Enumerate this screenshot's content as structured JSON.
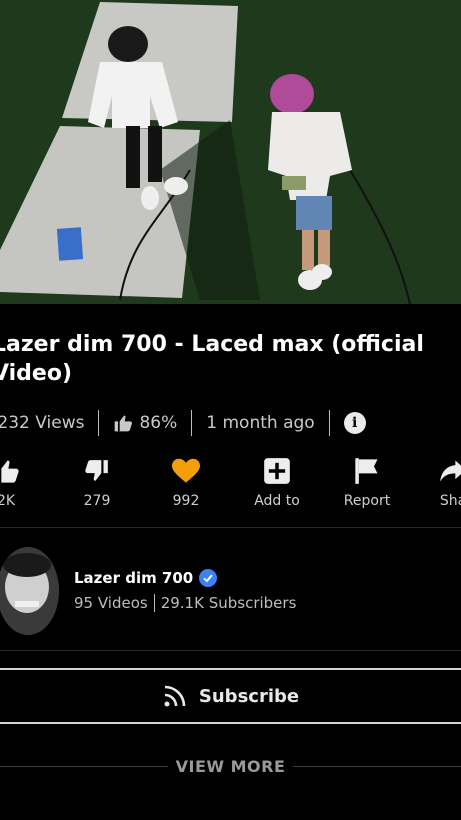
{
  "video": {
    "title": "Lazer dim 700 - Laced max (official Video)"
  },
  "stats": {
    "views": ",232 Views",
    "like_percent": "86%",
    "age": "1 month ago"
  },
  "actions": [
    {
      "icon": "thumbs-up-icon",
      "label": "2K"
    },
    {
      "icon": "thumbs-down-icon",
      "label": "279"
    },
    {
      "icon": "heart-icon",
      "label": "992"
    },
    {
      "icon": "add-box-icon",
      "label": "Add to"
    },
    {
      "icon": "flag-icon",
      "label": "Report"
    },
    {
      "icon": "share-icon",
      "label": "Sha"
    }
  ],
  "channel": {
    "name": "Lazer dim 700",
    "videos": "95 Videos",
    "subscribers": "29.1K Subscribers"
  },
  "subscribe_label": "Subscribe",
  "view_more_label": "VIEW MORE",
  "colors": {
    "background": "#000000",
    "heart": "#f59e0b",
    "verified": "#3b82f6"
  }
}
